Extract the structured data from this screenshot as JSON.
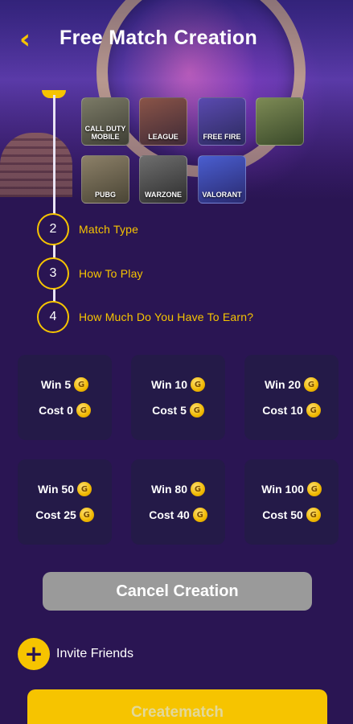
{
  "header": {
    "back_icon": "chevron-left-icon",
    "back_glyph": "‹",
    "title": "Free Match Creation"
  },
  "games": [
    {
      "label": "CALL DUTY MOBILE",
      "bg": "#5a5a4a"
    },
    {
      "label": "LEAGUE",
      "bg": "#6b3b3b"
    },
    {
      "label": "FREE FIRE",
      "bg": "#3a3c7a"
    },
    {
      "label": "",
      "bg": "#4d5a3a"
    },
    {
      "label": "PUBG",
      "bg": "#6a6350"
    },
    {
      "label": "WARZONE",
      "bg": "#4a4a4a"
    },
    {
      "label": "VALORANT",
      "bg": "#2c3a8a"
    }
  ],
  "steps": [
    {
      "number": "2",
      "label": "Match Type"
    },
    {
      "number": "3",
      "label": "How To Play"
    },
    {
      "number": "4",
      "label": "How Much Do You Have To Earn?"
    }
  ],
  "coin_glyph": "G",
  "prize_cards": [
    {
      "win": "Win 5",
      "cost": "Cost 0"
    },
    {
      "win": "Win 10",
      "cost": "Cost 5"
    },
    {
      "win": "Win 20",
      "cost": "Cost 10"
    },
    {
      "win": "Win 50",
      "cost": "Cost 25"
    },
    {
      "win": "Win 80",
      "cost": "Cost 40"
    },
    {
      "win": "Win 100",
      "cost": "Cost 50"
    }
  ],
  "cancel_label": "Cancel Creation",
  "invite": {
    "icon": "plus-icon",
    "glyph": "+",
    "label": "Invite Friends"
  },
  "create_label": "Creatematch",
  "colors": {
    "accent": "#f6c400",
    "background": "#2a1553",
    "card": "#241a48",
    "cancel": "#9a9a9a"
  }
}
